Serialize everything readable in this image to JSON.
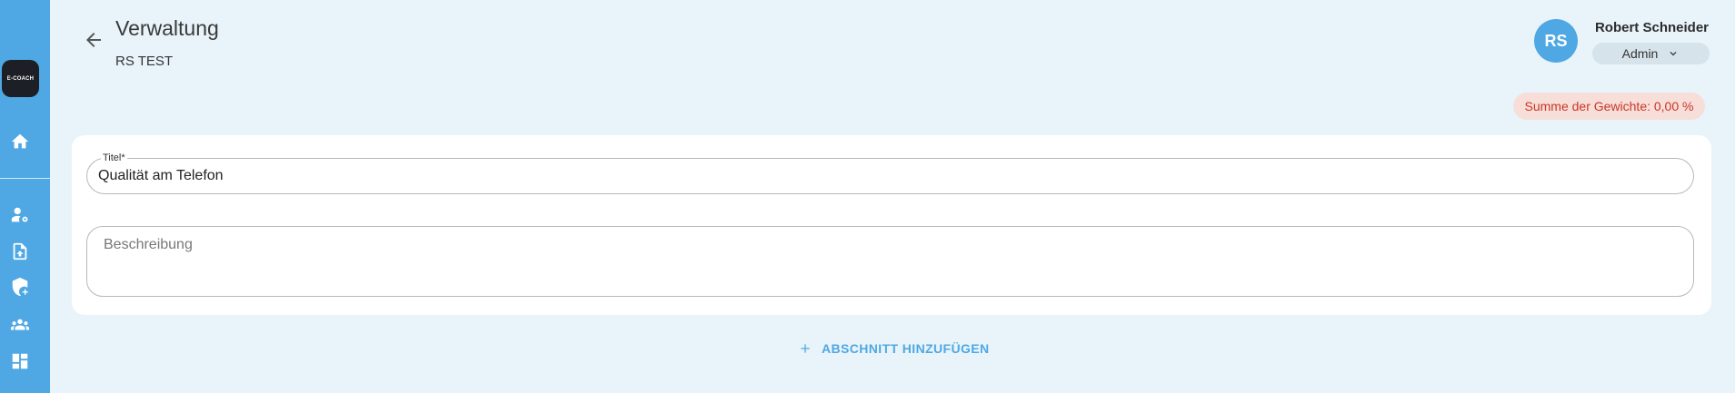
{
  "sidebar": {
    "logo_text": "E-COACH",
    "nav_icons": [
      "home-icon",
      "user-settings-icon",
      "file-upload-icon",
      "shield-add-icon",
      "groups-icon",
      "dashboard-icon"
    ]
  },
  "header": {
    "title": "Verwaltung",
    "subtitle": "RS TEST"
  },
  "user": {
    "initials": "RS",
    "name": "Robert Schneider",
    "role": "Admin"
  },
  "weight_badge": {
    "text": "Summe der Gewichte: 0,00 %"
  },
  "form": {
    "title_label": "Titel*",
    "title_value": "Qualität am Telefon",
    "description_placeholder": "Beschreibung"
  },
  "actions": {
    "add_section_label": "ABSCHNITT HINZUFÜGEN"
  },
  "colors": {
    "accent": "#4fa8e3",
    "background": "#e8f4fa",
    "badge_bg": "#f8ded8",
    "badge_text": "#c93626"
  }
}
